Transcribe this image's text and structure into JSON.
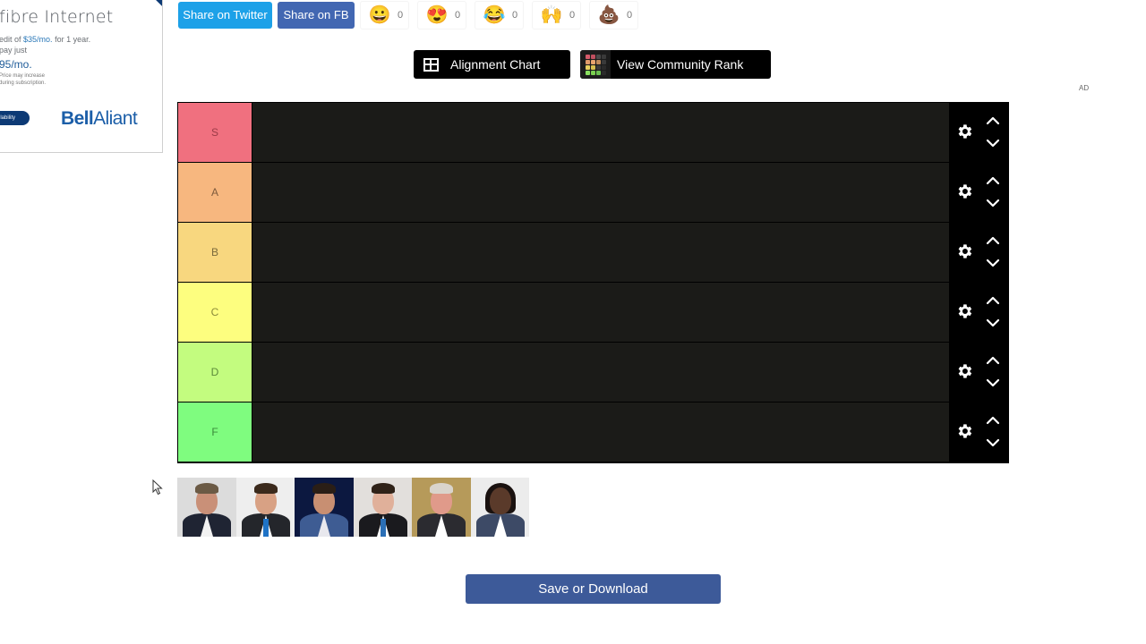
{
  "ad": {
    "title": "fibre Internet",
    "line1_prefix": "edit of ",
    "line1_highlight": "$35/mo.",
    "line1_suffix": " for 1 year.",
    "line2": "pay just",
    "price": "95/mo.",
    "fine_print_1": "Price may increase",
    "fine_print_2": "during subscription.",
    "pill_label": "ilability",
    "brand_bold": "Bell",
    "brand_light": "Aliant"
  },
  "share": {
    "twitter_label": "Share on Twitter",
    "fb_label": "Share on FB"
  },
  "reactions": [
    {
      "name": "grinning",
      "emoji": "😀",
      "count": "0"
    },
    {
      "name": "heart-eyes",
      "emoji": "😍",
      "count": "0"
    },
    {
      "name": "tears-of-joy",
      "emoji": "😂",
      "count": "0"
    },
    {
      "name": "raising-hands",
      "emoji": "🙌",
      "count": "0"
    },
    {
      "name": "poop",
      "emoji": "💩",
      "count": "0"
    }
  ],
  "actions": {
    "alignment_chart_label": "Alignment Chart",
    "community_rank_label": "View Community Rank"
  },
  "ad_label": "AD",
  "tiers": [
    {
      "label": "S",
      "color": "#f0707f",
      "text_color": "#9b3b47"
    },
    {
      "label": "A",
      "color": "#f7b77f",
      "text_color": "#7d5a3c"
    },
    {
      "label": "B",
      "color": "#f8d77f",
      "text_color": "#7a6a3c"
    },
    {
      "label": "C",
      "color": "#fdfe7f",
      "text_color": "#8a8a3a"
    },
    {
      "label": "D",
      "color": "#c3fc7f",
      "text_color": "#5c8a3a"
    },
    {
      "label": "F",
      "color": "#7ffc7f",
      "text_color": "#3a8a3a"
    }
  ],
  "tray_items": [
    {
      "name": "candidate-1",
      "bg": "#dcdcdc",
      "suit": "#1f2433",
      "shirt": "#f2f2f2",
      "skin": "#c99078",
      "hair": "#6b5a45",
      "tie": null
    },
    {
      "name": "candidate-2",
      "bg": "#eeeeee",
      "suit": "#24262b",
      "shirt": "#ffffff",
      "skin": "#d8a184",
      "hair": "#3b2a1c",
      "tie": "#1f73c6"
    },
    {
      "name": "candidate-3",
      "bg": "#0c1840",
      "suit": "#3e5c93",
      "shirt": "#e8e8ee",
      "skin": "#c88f72",
      "hair": "#2a1e16",
      "tie": null
    },
    {
      "name": "candidate-4",
      "bg": "#e2dfdc",
      "suit": "#1a1a1e",
      "shirt": "#ffffff",
      "skin": "#e0b09a",
      "hair": "#2f2218",
      "tie": "#2b6fb6"
    },
    {
      "name": "candidate-5",
      "bg": "#b69a5a",
      "suit": "#2b2b30",
      "shirt": "#ffffff",
      "skin": "#e09a8a",
      "hair": "#d9d4cc",
      "tie": null
    },
    {
      "name": "candidate-6",
      "bg": "#ececec",
      "suit": "#3d4a66",
      "shirt": "#ffffff",
      "skin": "#5a3a2a",
      "hair": "#1a1210",
      "tie": null
    }
  ],
  "save": {
    "label": "Save or Download"
  },
  "colors": {
    "twitter": "#1da1e8",
    "facebook": "#4267b2",
    "save": "#3d5a99",
    "tier_bg": "#1b1b18"
  }
}
